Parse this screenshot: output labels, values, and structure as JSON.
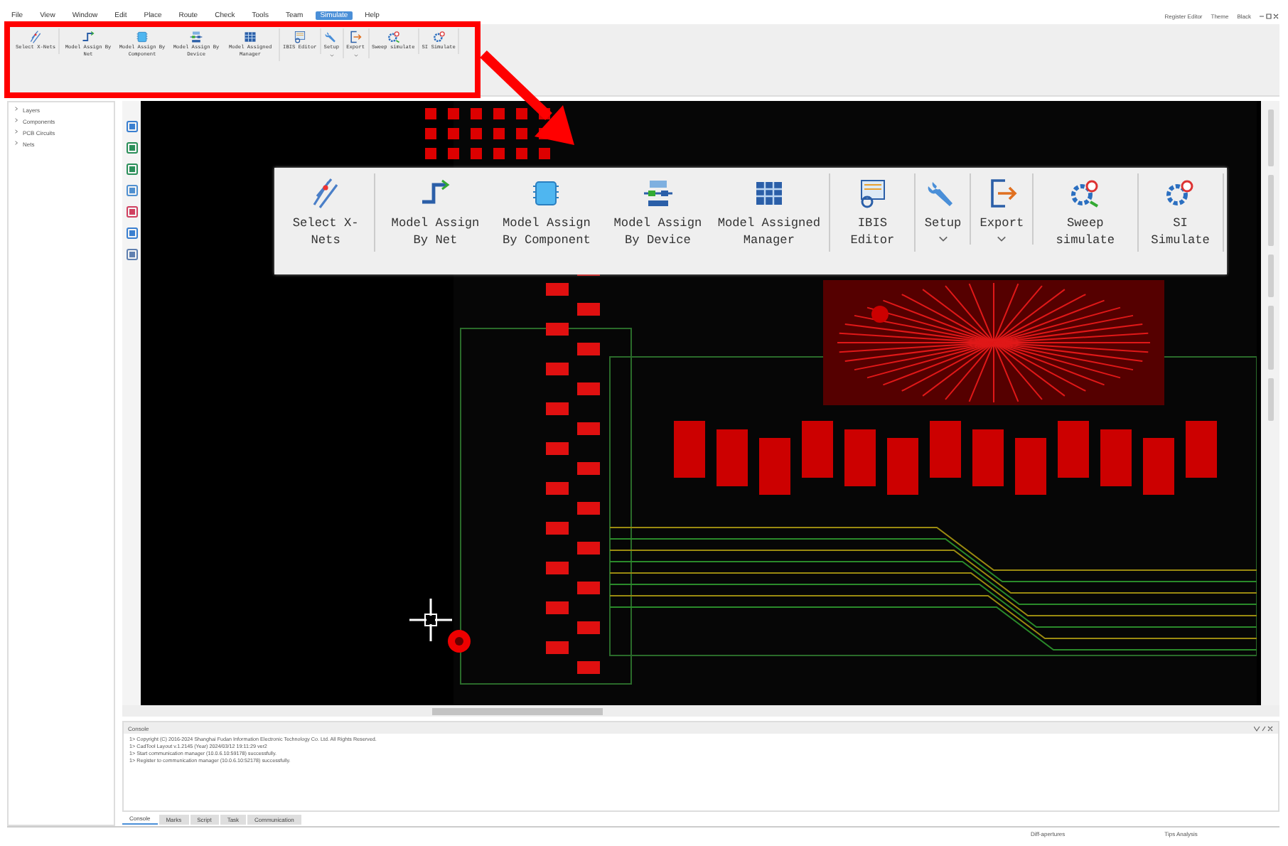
{
  "menu": [
    {
      "label": "File",
      "selected": false
    },
    {
      "label": "View",
      "selected": false
    },
    {
      "label": "Window",
      "selected": false
    },
    {
      "label": "Edit",
      "selected": false
    },
    {
      "label": "Place",
      "selected": false
    },
    {
      "label": "Route",
      "selected": false
    },
    {
      "label": "Check",
      "selected": false
    },
    {
      "label": "Tools",
      "selected": false
    },
    {
      "label": "Team",
      "selected": false
    },
    {
      "label": "Simulate",
      "selected": true
    },
    {
      "label": "Help",
      "selected": false
    }
  ],
  "title_bar": {
    "mode": "Register Editor",
    "theme": "Theme",
    "skin": "Black"
  },
  "ribbon": {
    "groups": [
      [
        {
          "label": "Select X-Nets",
          "kind": "xnets",
          "dropdown": false
        }
      ],
      [
        {
          "label": "Model Assign By Net",
          "kind": "net",
          "dropdown": false
        },
        {
          "label": "Model Assign By Component",
          "kind": "component",
          "dropdown": false
        },
        {
          "label": "Model Assign By Device",
          "kind": "device",
          "dropdown": false
        },
        {
          "label": "Model Assigned Manager",
          "kind": "manager",
          "dropdown": false
        }
      ],
      [
        {
          "label": "IBIS Editor",
          "kind": "ibis",
          "dropdown": false
        }
      ],
      [
        {
          "label": "Setup",
          "kind": "setup",
          "dropdown": true
        }
      ],
      [
        {
          "label": "Export",
          "kind": "export",
          "dropdown": true
        }
      ],
      [
        {
          "label": "Sweep simulate",
          "kind": "sweep",
          "dropdown": false
        }
      ],
      [
        {
          "label": "SI Simulate",
          "kind": "simulate",
          "dropdown": false
        }
      ]
    ]
  },
  "callout": {
    "groups": [
      [
        {
          "label": "Select X-Nets",
          "kind": "xnets",
          "dropdown": false
        }
      ],
      [
        {
          "label": "Model Assign By Net",
          "kind": "net",
          "dropdown": false
        },
        {
          "label": "Model Assign By Component",
          "kind": "component",
          "dropdown": false
        },
        {
          "label": "Model Assign By Device",
          "kind": "device",
          "dropdown": false
        },
        {
          "label": "Model Assigned Manager",
          "kind": "manager",
          "dropdown": false
        }
      ],
      [
        {
          "label": "IBIS Editor",
          "kind": "ibis",
          "dropdown": false
        }
      ],
      [
        {
          "label": "Setup",
          "kind": "setup",
          "dropdown": true
        }
      ],
      [
        {
          "label": "Export",
          "kind": "export",
          "dropdown": true
        }
      ],
      [
        {
          "label": "Sweep simulate",
          "kind": "sweep",
          "dropdown": false
        }
      ],
      [
        {
          "label": "SI Simulate",
          "kind": "simulate",
          "dropdown": false
        }
      ]
    ]
  },
  "sidebar": {
    "items": [
      {
        "label": "Layers",
        "expanded": false
      },
      {
        "label": "Components",
        "expanded": false
      },
      {
        "label": "PCB Circuits",
        "expanded": false
      },
      {
        "label": "Nets",
        "expanded": false
      }
    ]
  },
  "console": {
    "title": "Console",
    "lines": [
      "1> Copyright (C) 2016-2024 Shanghai Fudan Information Electronic Technology Co. Ltd. All Rights Reserved.",
      "1> CadTool Layout v.1.2145 (Year) 2024/03/12 19:11:29 ver2",
      "1> Start communication manager (10.0.6.10:59178) successfully.",
      "1> Register to communication manager (10.0.6.10:52178) successfully."
    ],
    "tabs": [
      {
        "label": "Console",
        "selected": true
      },
      {
        "label": "Marks",
        "selected": false
      },
      {
        "label": "Script",
        "selected": false
      },
      {
        "label": "Task",
        "selected": false
      },
      {
        "label": "Communication",
        "selected": false
      }
    ]
  },
  "status_bar": [
    "Diff-apertures",
    "Tips Analysis"
  ]
}
